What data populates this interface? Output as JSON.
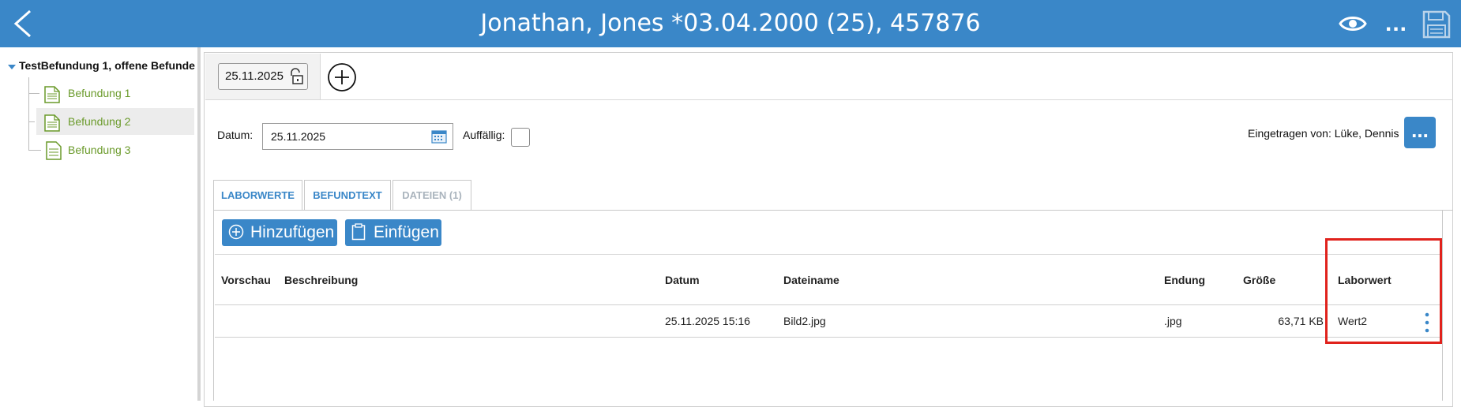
{
  "header": {
    "title": "Jonathan, Jones *03.04.2000 (25), 457876",
    "more_label": "...",
    "colors": {
      "bar": "#3a87c8",
      "text": "#ffffff"
    },
    "icons": [
      "back-arrow-icon",
      "eye-icon",
      "more-horizontal-icon",
      "save-floppy-icon"
    ]
  },
  "tree": {
    "root_label": "TestBefundung 1, offene Befunde",
    "items": [
      {
        "label": "Befundung 1",
        "selected": false
      },
      {
        "label": "Befundung 2",
        "selected": true
      },
      {
        "label": "Befundung 3",
        "selected": false
      }
    ],
    "item_color": "#6a9a2a"
  },
  "record": {
    "date_chip": "25.11.2025",
    "datum_label": "Datum:",
    "datum_value": "25.11.2025",
    "auffaellig_label": "Auffällig:",
    "auffaellig_checked": false,
    "author_label": "Eingetragen von: Lüke, Dennis",
    "author_more_label": "..."
  },
  "tabs": [
    {
      "label": "LABORWERTE",
      "active": true
    },
    {
      "label": "BEFUNDTEXT",
      "active": true
    },
    {
      "label": "DATEIEN (1)",
      "active": false
    }
  ],
  "actions": {
    "add_label": "Hinzufügen",
    "paste_label": "Einfügen"
  },
  "table": {
    "headers": {
      "preview": "Vorschau",
      "description": "Beschreibung",
      "date": "Datum",
      "filename": "Dateiname",
      "extension": "Endung",
      "size": "Größe",
      "labvalue": "Laborwert"
    },
    "rows": [
      {
        "preview": "",
        "description": "",
        "date": "25.11.2025 15:16",
        "filename": "Bild2.jpg",
        "extension": ".jpg",
        "size": "63,71 KB",
        "labvalue": "Wert2"
      }
    ]
  },
  "highlight_color": "#e0221c"
}
